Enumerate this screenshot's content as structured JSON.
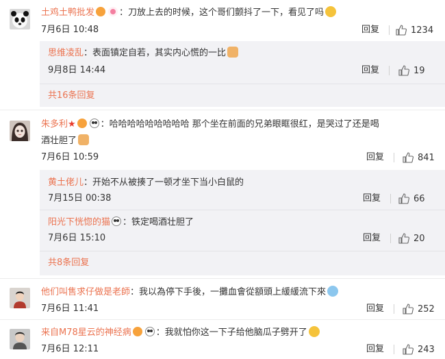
{
  "reply_label": "回复",
  "comments": [
    {
      "user": "土鸡土鸭批发",
      "text": "：刀放上去的时候，这个哥们颤抖了一下，看见了吗",
      "time": "7月6日 10:48",
      "likes": "1234",
      "avatar": "panda-avatar",
      "replies": [
        {
          "user": "思维凌乱",
          "text": "：表面镇定自若，其实内心慌的一比",
          "time": "9月8日 14:44",
          "likes": "19"
        }
      ],
      "more": "共16条回复"
    },
    {
      "user": "朱多利",
      "text": "：哈哈哈哈哈哈哈哈哈 那个坐在前面的兄弟眼眶很红，是哭过了还是喝",
      "text2": "酒壮胆了",
      "time": "7月6日 10:59",
      "likes": "841",
      "avatar": "girl-avatar",
      "replies": [
        {
          "user": "黄土佬儿",
          "text": "：开始不从被揍了一顿才坐下当小白鼠的",
          "time": "7月15日 00:38",
          "likes": "66"
        },
        {
          "user": "阳光下恍惚的猫",
          "text": "：铁定喝酒壮胆了",
          "time": "7月6日 15:10",
          "likes": "20"
        }
      ],
      "more": "共8条回复"
    },
    {
      "user": "他们叫售求仔做是老師",
      "text": "：我以為停下手後，一攤血會從額頭上緩緩流下來",
      "time": "7月6日 11:41",
      "likes": "252",
      "avatar": "man-avatar"
    },
    {
      "user": "来自M78星云的神经病",
      "text": "：我就怕你这一下子给他脑瓜子劈开了",
      "time": "7月6日 12:11",
      "likes": "243",
      "avatar": "boy-avatar"
    }
  ],
  "colors": {
    "accent": "#eb7350",
    "panel": "#f2f2f5"
  }
}
